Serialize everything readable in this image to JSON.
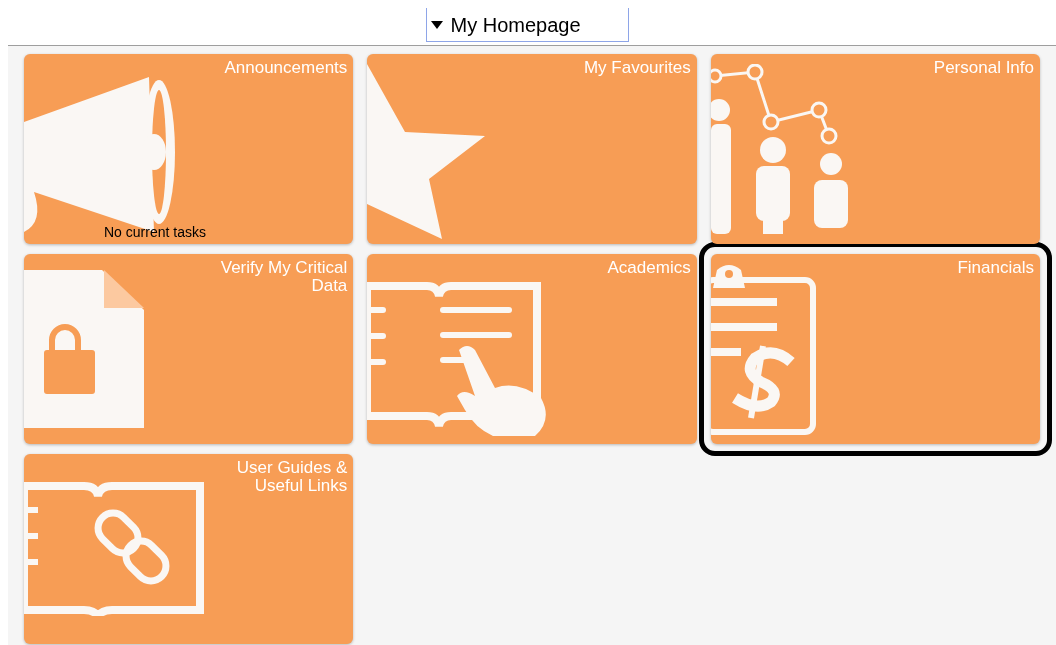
{
  "header": {
    "menu_label": "My Homepage"
  },
  "tiles": [
    {
      "title": "Announcements",
      "kind": "megaphone",
      "subtitle": "No current tasks",
      "highlighted": false
    },
    {
      "title": "My Favourites",
      "kind": "star",
      "highlighted": false
    },
    {
      "title": "Personal Info",
      "kind": "people",
      "highlighted": false
    },
    {
      "title": "Verify My Critical Data",
      "kind": "locked-document",
      "highlighted": false
    },
    {
      "title": "Academics",
      "kind": "book-hand",
      "highlighted": false
    },
    {
      "title": "Financials",
      "kind": "clipboard-dollar",
      "highlighted": true
    },
    {
      "title": "User Guides & Useful Links",
      "kind": "book-link",
      "highlighted": false
    }
  ]
}
